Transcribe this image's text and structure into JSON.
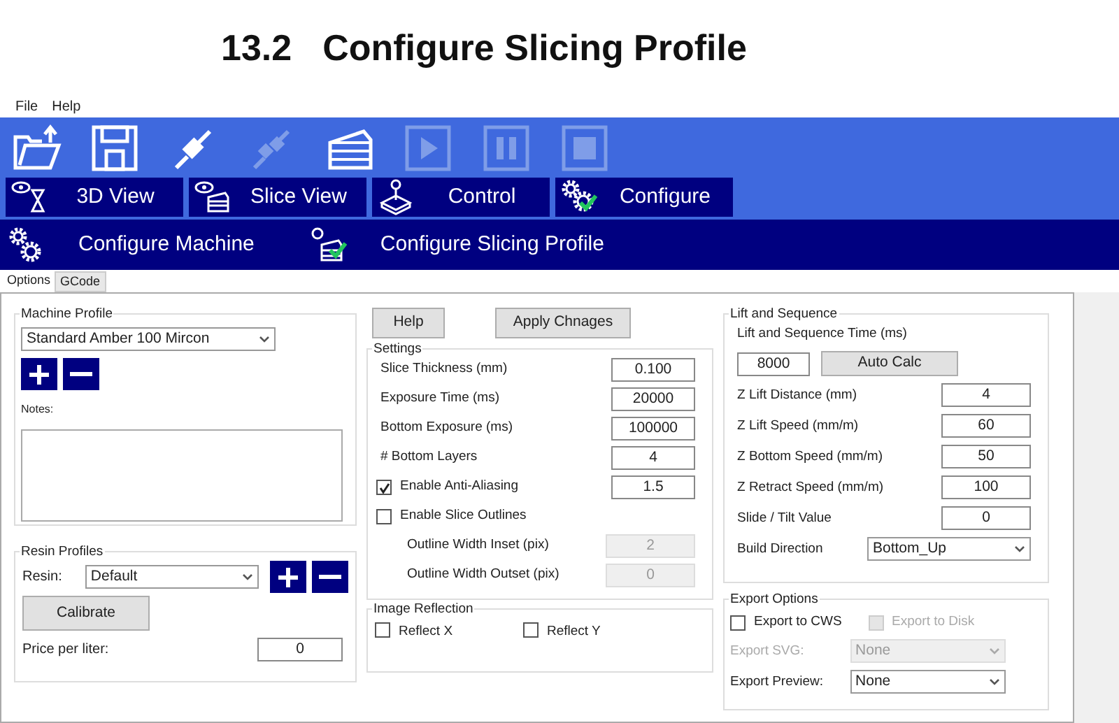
{
  "heading": {
    "number": "13.2",
    "title": "Configure Slicing Profile"
  },
  "menu": [
    "File",
    "Help"
  ],
  "toolbar": [
    {
      "kind": "open",
      "disabled": false
    },
    {
      "kind": "save",
      "disabled": false
    },
    {
      "kind": "connect",
      "disabled": false
    },
    {
      "kind": "disconnect",
      "disabled": true
    },
    {
      "kind": "slice",
      "disabled": false
    },
    {
      "kind": "play",
      "disabled": true
    },
    {
      "kind": "pause",
      "disabled": true
    },
    {
      "kind": "stop",
      "disabled": true
    }
  ],
  "nav_tabs": [
    {
      "label": "3D View",
      "kind": "view3d"
    },
    {
      "label": "Slice View",
      "kind": "slice"
    },
    {
      "label": "Control",
      "kind": "joystick"
    },
    {
      "label": "Configure",
      "kind": "configure"
    }
  ],
  "sub_nav": [
    {
      "label": "Configure Machine",
      "kind": "gears"
    },
    {
      "label": "Configure Slicing Profile",
      "kind": "slicing"
    }
  ],
  "page_tabs": [
    {
      "label": "Options",
      "selected": true
    },
    {
      "label": "GCode",
      "selected": false
    }
  ],
  "machine_profile": {
    "title": "Machine Profile",
    "value": "Standard Amber 100 Mircon",
    "notes_label": "Notes:"
  },
  "resin_profiles": {
    "title": "Resin Profiles",
    "resin_label": "Resin:",
    "resin_value": "Default",
    "calibrate": "Calibrate",
    "price_label": "Price per liter:",
    "price_value": "0"
  },
  "buttons": [
    "Help",
    "Apply Chnages"
  ],
  "settings": {
    "title": "Settings",
    "rows": [
      {
        "kind": "field",
        "label": "Slice Thickness (mm)",
        "value": "0.100"
      },
      {
        "kind": "field",
        "label": "Exposure Time (ms)",
        "value": "20000"
      },
      {
        "kind": "field",
        "label": "Bottom Exposure (ms)",
        "value": "100000"
      },
      {
        "kind": "field",
        "label": "# Bottom Layers",
        "value": "4"
      },
      {
        "kind": "check_field",
        "label": "Enable Anti-Aliasing",
        "checked": true,
        "value": "1.5"
      },
      {
        "kind": "check",
        "label": "Enable Slice Outlines",
        "checked": false
      },
      {
        "kind": "sub_field",
        "label": "Outline Width Inset (pix)",
        "value": "2",
        "disabled": true
      },
      {
        "kind": "sub_field",
        "label": "Outline Width Outset (pix)",
        "value": "0",
        "disabled": true
      }
    ]
  },
  "image_reflection": {
    "title": "Image Reflection",
    "options": [
      {
        "label": "Reflect X",
        "checked": false
      },
      {
        "label": "Reflect Y",
        "checked": false
      }
    ]
  },
  "lift_sequence": {
    "title": "Lift and Sequence",
    "time_label": "Lift and Sequence Time (ms)",
    "time_value": "8000",
    "auto_calc": "Auto Calc",
    "rows": [
      {
        "kind": "field",
        "label": "Z Lift Distance (mm)",
        "value": "4"
      },
      {
        "kind": "field",
        "label": "Z Lift Speed (mm/m)",
        "value": "60"
      },
      {
        "kind": "field",
        "label": "Z Bottom Speed (mm/m)",
        "value": "50"
      },
      {
        "kind": "field",
        "label": "Z Retract Speed (mm/m)",
        "value": "100"
      },
      {
        "kind": "field",
        "label": "Slide / Tilt Value",
        "value": "0"
      },
      {
        "kind": "select",
        "label": "Build Direction",
        "value": "Bottom_Up"
      }
    ]
  },
  "export_options": {
    "title": "Export Options",
    "checks": [
      {
        "label": "Export to CWS",
        "checked": false,
        "disabled": false
      },
      {
        "label": "Export to Disk",
        "checked": false,
        "disabled": true
      }
    ],
    "selects": [
      {
        "label": "Export SVG:",
        "value": "None",
        "disabled": true
      },
      {
        "label": "Export Preview:",
        "value": "None",
        "disabled": false
      }
    ]
  }
}
